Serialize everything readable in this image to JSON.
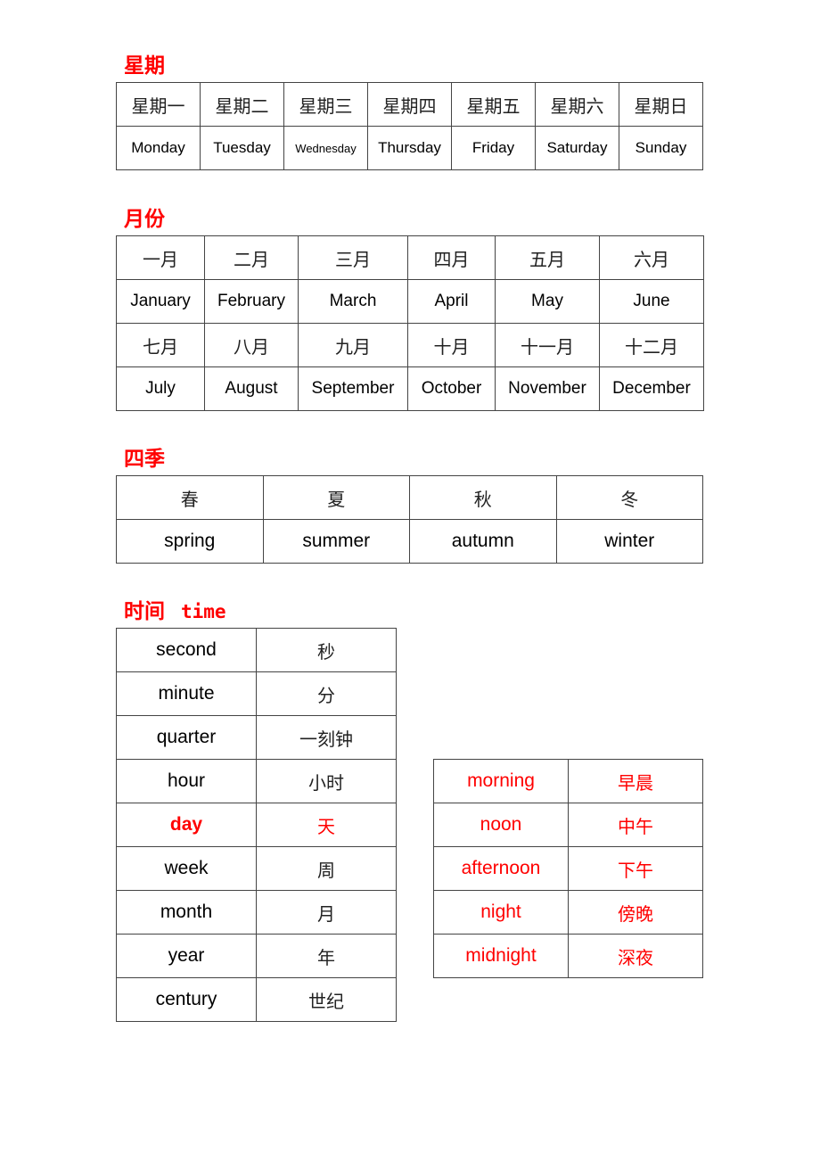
{
  "weekdays": {
    "heading": "星期",
    "zh": [
      "星期一",
      "星期二",
      "星期三",
      "星期四",
      "星期五",
      "星期六",
      "星期日"
    ],
    "en": [
      "Monday",
      "Tuesday",
      "Wednesday",
      "Thursday",
      "Friday",
      "Saturday",
      "Sunday"
    ]
  },
  "months": {
    "heading": "月份",
    "zh": [
      "一月",
      "二月",
      "三月",
      "四月",
      "五月",
      "六月",
      "七月",
      "八月",
      "九月",
      "十月",
      "十一月",
      "十二月"
    ],
    "en": [
      "January",
      "February",
      "March",
      "April",
      "May",
      "June",
      "July",
      "August",
      "September",
      "October",
      "November",
      "December"
    ]
  },
  "seasons": {
    "heading": "四季",
    "zh": [
      "春",
      "夏",
      "秋",
      "冬"
    ],
    "en": [
      "spring",
      "summer",
      "autumn",
      "winter"
    ]
  },
  "time": {
    "heading": "时间",
    "heading_en": "time",
    "units": [
      {
        "en": "second",
        "zh": "秒"
      },
      {
        "en": "minute",
        "zh": "分"
      },
      {
        "en": "quarter",
        "zh": "一刻钟"
      },
      {
        "en": "hour",
        "zh": "小时"
      },
      {
        "en": "day",
        "zh": "天"
      },
      {
        "en": "week",
        "zh": "周"
      },
      {
        "en": "month",
        "zh": "月"
      },
      {
        "en": "year",
        "zh": "年"
      },
      {
        "en": "century",
        "zh": "世纪"
      }
    ],
    "day_parts": [
      {
        "en": "morning",
        "zh": "早晨"
      },
      {
        "en": "noon",
        "zh": "中午"
      },
      {
        "en": "afternoon",
        "zh": "下午"
      },
      {
        "en": "night",
        "zh": "傍晚"
      },
      {
        "en": "midnight",
        "zh": "深夜"
      }
    ]
  },
  "colors": {
    "accent": "#ff0000"
  }
}
